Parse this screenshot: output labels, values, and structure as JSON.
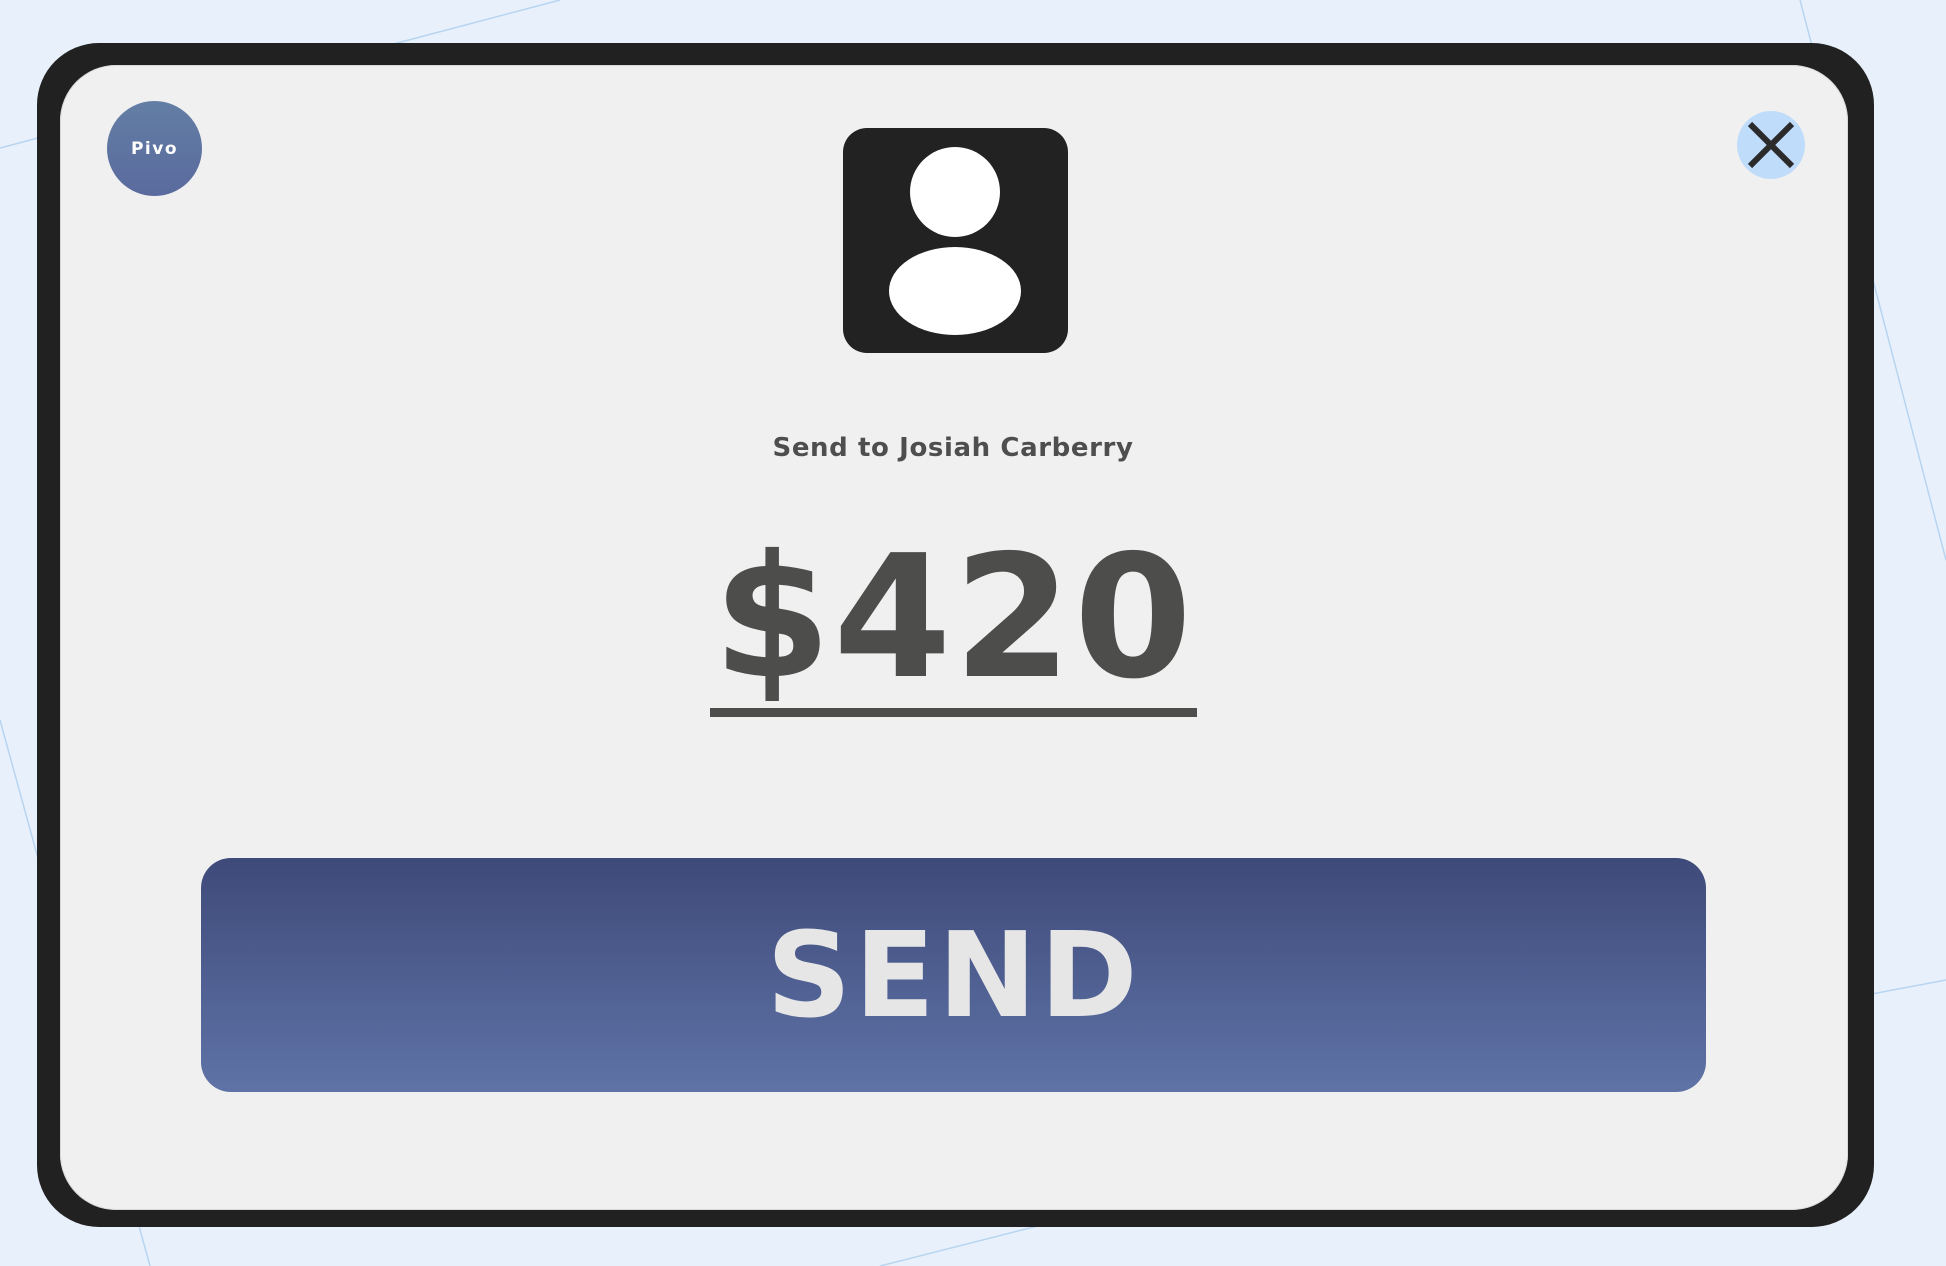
{
  "app": {
    "logo_text": "Pivo"
  },
  "payment": {
    "recipient_label": "Send to Josiah Carberry",
    "amount": "$420"
  },
  "actions": {
    "send_label": "SEND"
  },
  "icons": {
    "close": "close-icon",
    "avatar": "user-avatar-icon"
  },
  "colors": {
    "background": "#e8f1fb",
    "device_frame": "#212121",
    "screen": "#f0f0f0",
    "text": "#4d4d4b",
    "close_button": "#bfdcfb",
    "send_button_top": "#3e4a79",
    "send_button_bottom": "#5f73a7",
    "send_text": "#e6e6e6"
  }
}
